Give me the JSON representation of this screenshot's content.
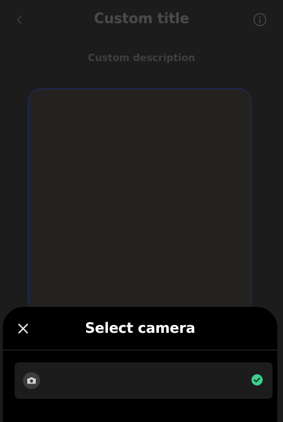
{
  "header": {
    "title": "Custom title",
    "back_icon": "chevron-left-icon",
    "info_icon": "info-circle-icon"
  },
  "main": {
    "description": "Custom description"
  },
  "sheet": {
    "title": "Select camera",
    "close_icon": "close-icon",
    "options": [
      {
        "label": "",
        "icon": "camera-icon",
        "selected": true
      }
    ]
  },
  "colors": {
    "background": "#1c1c1c",
    "sheet_background": "#000000",
    "option_background": "#1c1c1c",
    "frame_border": "#1e2f6e",
    "selected_check": "#3ecf8e",
    "title_dimmed": "#4a4a4a"
  }
}
